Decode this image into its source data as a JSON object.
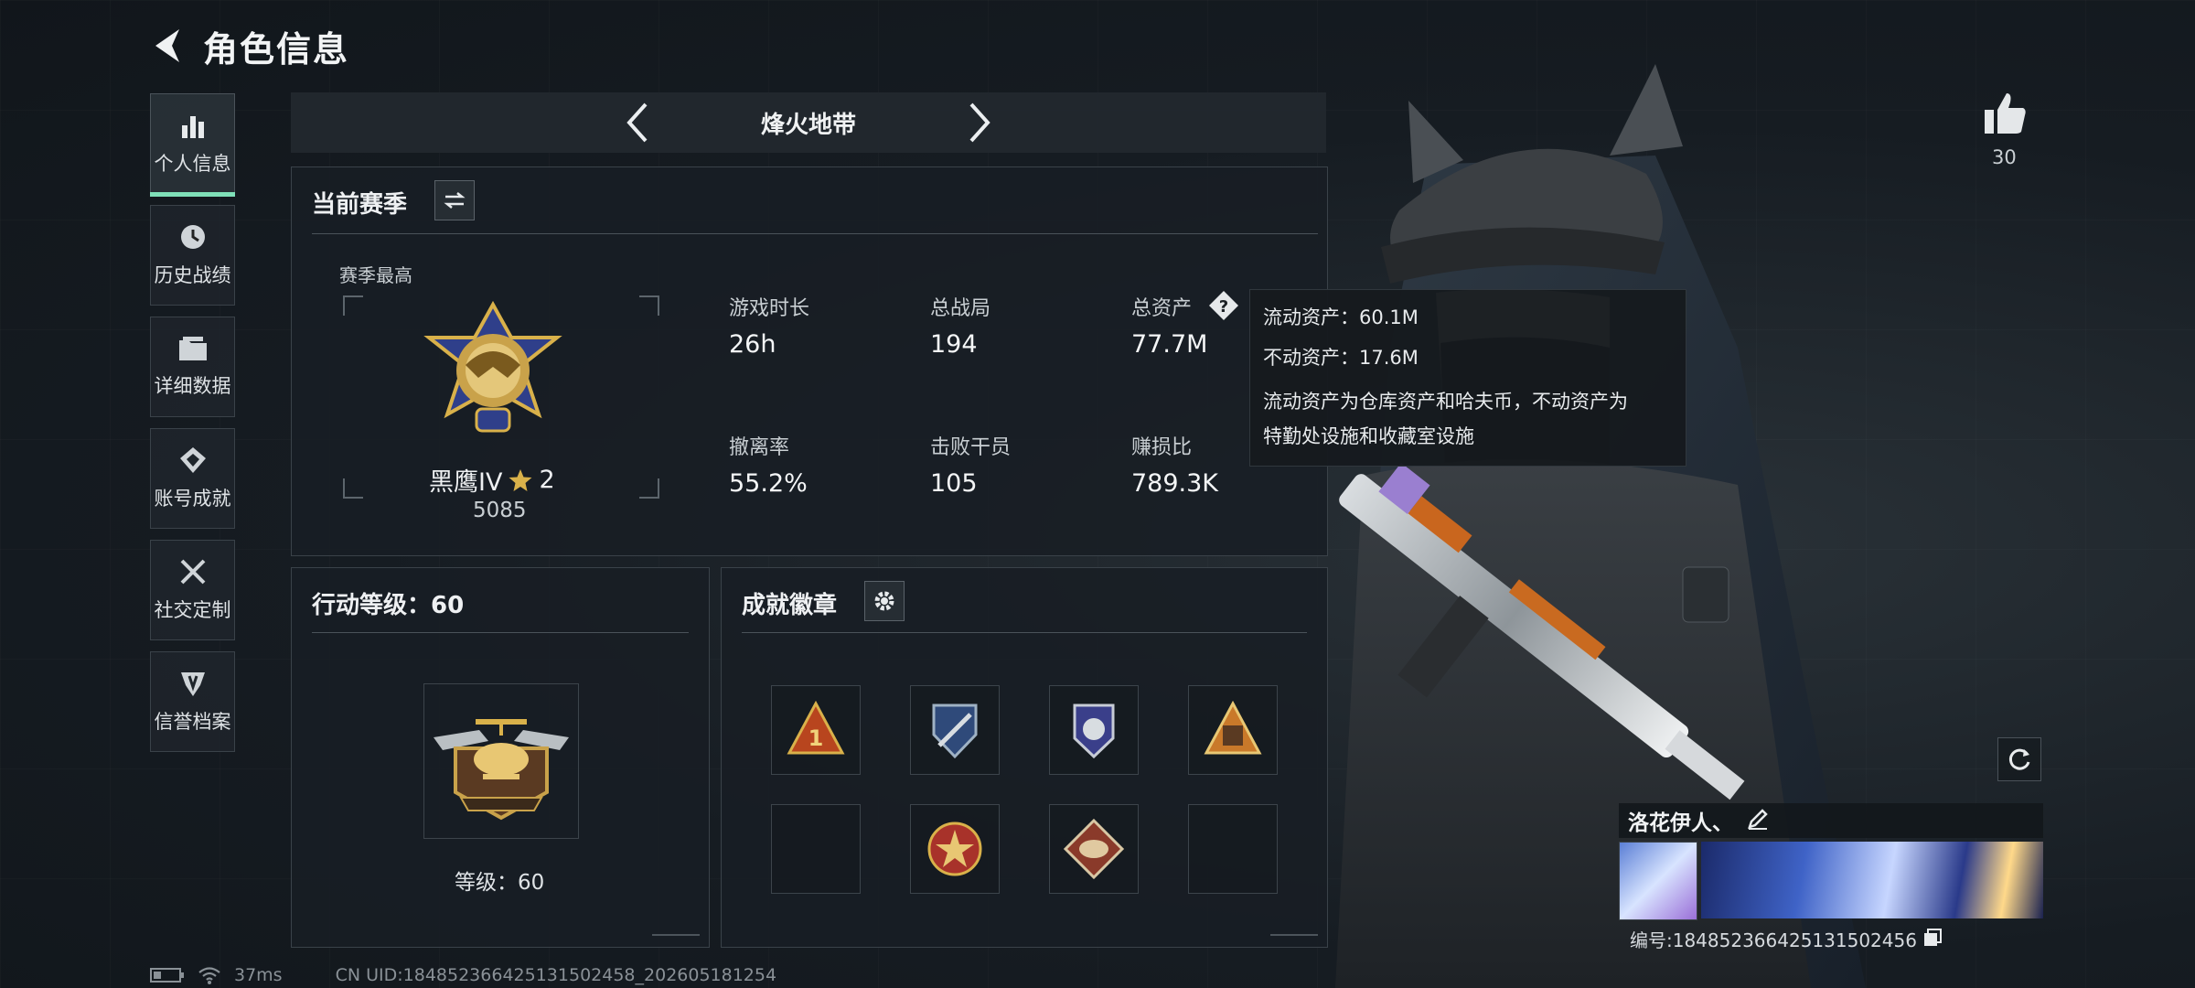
{
  "header": {
    "title": "角色信息"
  },
  "sidebar": {
    "items": [
      {
        "label": "个人信息",
        "icon": "bar-chart-icon",
        "active": true
      },
      {
        "label": "历史战绩",
        "icon": "clock-icon"
      },
      {
        "label": "详细数据",
        "icon": "folder-icon"
      },
      {
        "label": "账号成就",
        "icon": "achievement-icon"
      },
      {
        "label": "社交定制",
        "icon": "tools-icon"
      },
      {
        "label": "信誉档案",
        "icon": "shield-icon"
      }
    ]
  },
  "mode": {
    "name": "烽火地带"
  },
  "season": {
    "title": "当前赛季",
    "best_label": "赛季最高",
    "rank_name": "黑鹰IV",
    "rank_stars": "2",
    "rank_score": "5085",
    "stats": [
      {
        "label": "游戏时长",
        "value": "26h"
      },
      {
        "label": "总战局",
        "value": "194"
      },
      {
        "label": "总资产",
        "value": "77.7M"
      },
      {
        "label": "撤离率",
        "value": "55.2%"
      },
      {
        "label": "击败干员",
        "value": "105"
      },
      {
        "label": "赚损比",
        "value": "789.3K"
      }
    ]
  },
  "tooltip": {
    "liquid": "流动资产：60.1M",
    "fixed": "不动资产：17.6M",
    "desc_line1": "流动资产为仓库资产和哈夫币，不动资产为",
    "desc_line2": "特勤处设施和收藏室设施"
  },
  "action_level": {
    "title": "行动等级：60",
    "level_text": "等级：60"
  },
  "achievements": {
    "title": "成就徽章"
  },
  "likes": {
    "count": "30"
  },
  "player": {
    "name": "洛花伊人、",
    "id_text": "编号:1848523664251315024​56"
  },
  "status": {
    "ping": "37ms",
    "uid_text": "CN UID:1848523664251315024​58_202605181254"
  },
  "colors": {
    "accent": "#7fe0b8",
    "gold": "#d9b14a",
    "panel_border": "#3a4249"
  }
}
